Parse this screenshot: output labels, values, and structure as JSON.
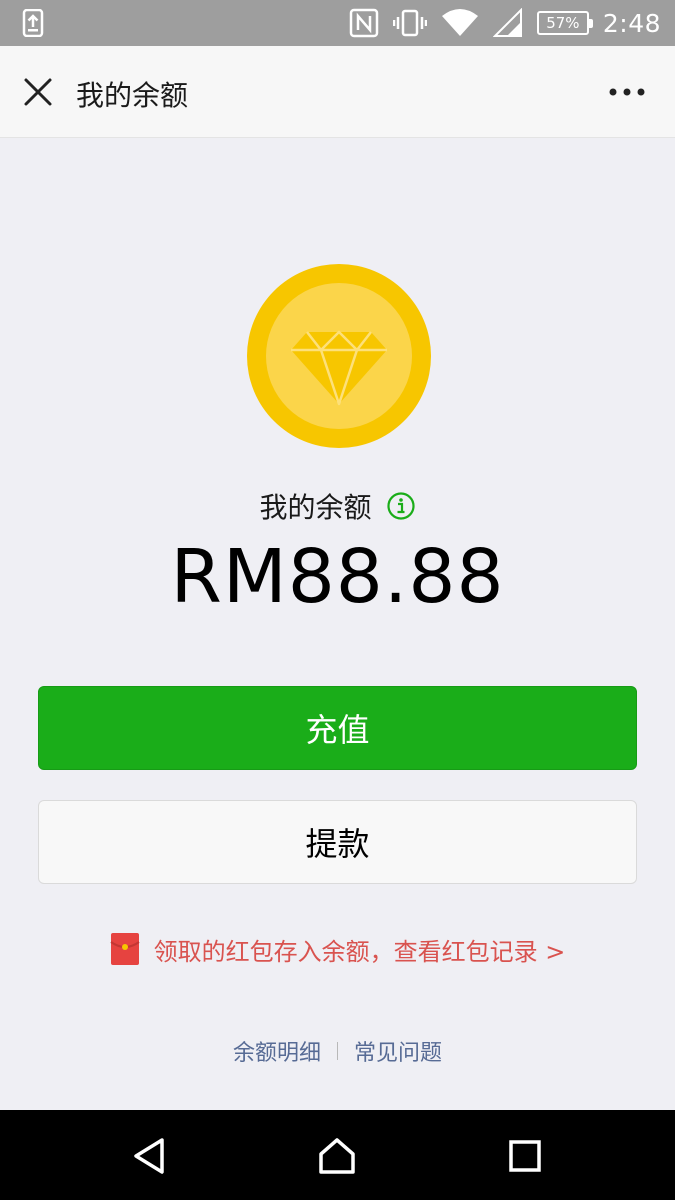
{
  "status_bar": {
    "battery": "57%",
    "time": "2:48"
  },
  "title_bar": {
    "title": "我的余额"
  },
  "balance": {
    "label": "我的余额",
    "amount": "RM88.88"
  },
  "actions": {
    "recharge_label": "充值",
    "withdraw_label": "提款"
  },
  "red_packet": {
    "text": "领取的红包存入余额，查看红包记录 >"
  },
  "footer": {
    "details_label": "余额明细",
    "faq_label": "常见问题"
  },
  "colors": {
    "primary_green": "#1aad19",
    "coin_yellow": "#f7c600",
    "red_packet": "#d9534f",
    "link_blue": "#576b95"
  },
  "icons": {
    "close": "close-icon",
    "more": "more-icon",
    "coin": "diamond-coin-icon",
    "info": "info-icon",
    "red_packet": "red-packet-icon",
    "back": "back-icon",
    "home": "home-icon",
    "recent": "recent-apps-icon"
  }
}
